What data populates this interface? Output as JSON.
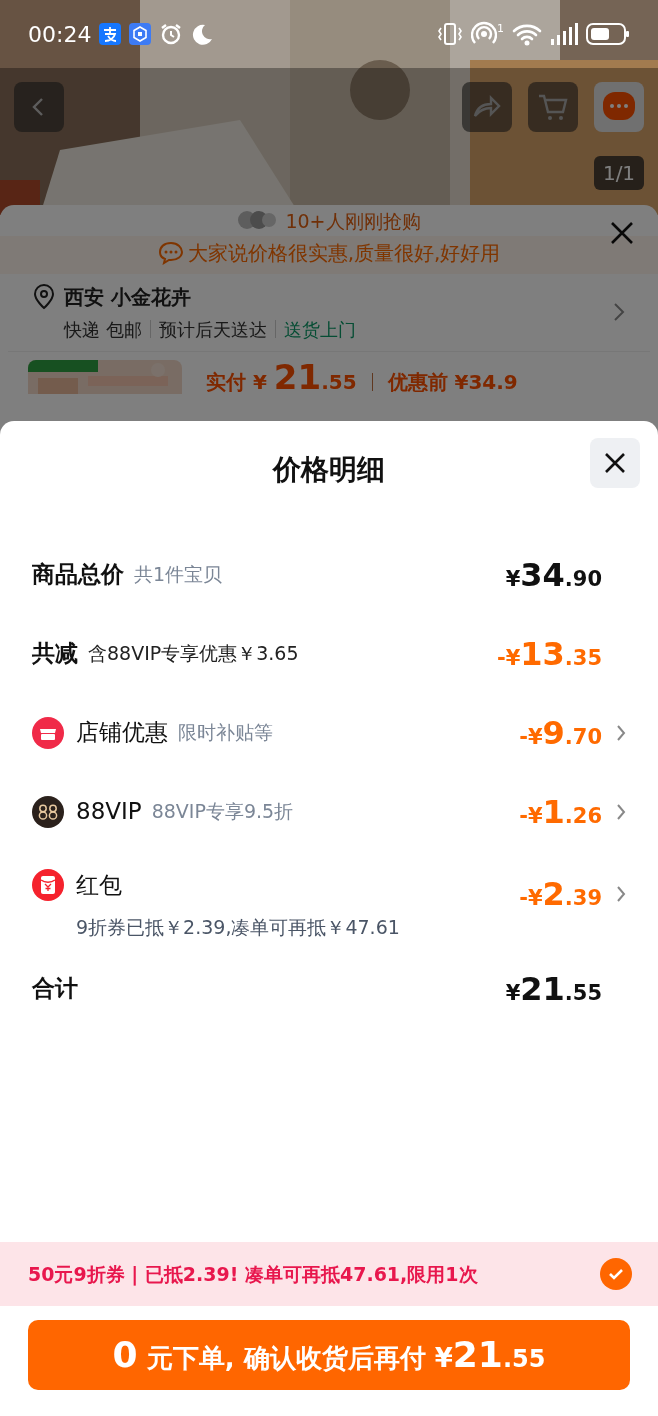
{
  "status_bar": {
    "time": "00:24",
    "hotspot_count": "1"
  },
  "product_header": {
    "image_counter": "1/1"
  },
  "background_sheet": {
    "buyers_note": "10+人刚刚抢购",
    "review_banner": "大家说价格很实惠,质量很好,好好用",
    "address": "西安 小金花卉",
    "delivery": [
      {
        "text": "快递 包邮",
        "highlight": false
      },
      {
        "text": "预计后天送达",
        "highlight": false
      },
      {
        "text": "送货上门",
        "highlight": true
      }
    ],
    "price": {
      "label": "实付",
      "currency": "¥",
      "integer": "21",
      "decimal": ".55",
      "original": "优惠前 ¥34.9"
    }
  },
  "price_detail": {
    "title": "价格明细",
    "rows": [
      {
        "kind": "subtotal",
        "label": "商品总价",
        "note": "共1件宝贝",
        "amount": {
          "prefix": "¥",
          "integer": "34",
          "decimal": ".90"
        }
      },
      {
        "kind": "reduction",
        "label": "共减",
        "note": "含88VIP专享优惠￥3.65",
        "amount": {
          "prefix": "-¥",
          "integer": "13",
          "decimal": ".35"
        }
      },
      {
        "kind": "shop",
        "label": "店铺优惠",
        "note": "限时补贴等",
        "amount": {
          "prefix": "-¥",
          "integer": "9",
          "decimal": ".70"
        }
      },
      {
        "kind": "membership",
        "label": "88VIP",
        "note": "88VIP专享9.5折",
        "amount": {
          "prefix": "-¥",
          "integer": "1",
          "decimal": ".26"
        }
      },
      {
        "kind": "envelope",
        "label": "红包",
        "detail": "9折券已抵￥2.39,凑单可再抵￥47.61",
        "amount": {
          "prefix": "-¥",
          "integer": "2",
          "decimal": ".39"
        }
      },
      {
        "kind": "total",
        "label": "合计",
        "amount": {
          "prefix": "¥",
          "integer": "21",
          "decimal": ".55"
        }
      }
    ]
  },
  "coupon_bar": {
    "text": "50元9折券 | 已抵2.39! 凑单可再抵47.61,限用1次",
    "checked": true
  },
  "submit_button": {
    "lead": "0",
    "middle": "元下单, 确认收货后再付 ¥",
    "integer": "21",
    "decimal": ".55"
  }
}
